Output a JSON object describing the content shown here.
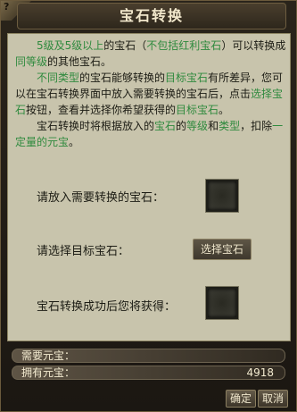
{
  "window": {
    "title": "宝石转换",
    "corner_text": "?"
  },
  "description": {
    "p1": [
      {
        "text": "5级及5级以上",
        "color": "#2f8a3e"
      },
      {
        "text": "的宝石（",
        "color": ""
      },
      {
        "text": "不包括红利宝石",
        "color": "#2f8a3e"
      },
      {
        "text": "）可以转换成",
        "color": ""
      },
      {
        "text": "同等级",
        "color": "#2f8a3e"
      },
      {
        "text": "的其他宝石。",
        "color": ""
      }
    ],
    "p2": [
      {
        "text": "不同类型",
        "color": "#2f8a3e"
      },
      {
        "text": "的宝石能够转换的",
        "color": ""
      },
      {
        "text": "目标宝石",
        "color": "#2f8a3e"
      },
      {
        "text": "有所差异，您可以在宝石转换界面中放入需要转换的宝石后，点击",
        "color": ""
      },
      {
        "text": "选择宝石",
        "color": "#2f8a3e"
      },
      {
        "text": "按钮，查看并选择你希望获得的",
        "color": ""
      },
      {
        "text": "目标宝石",
        "color": "#2f8a3e"
      },
      {
        "text": "。",
        "color": ""
      }
    ],
    "p3": [
      {
        "text": "宝石转换时将根据放入的",
        "color": ""
      },
      {
        "text": "宝石",
        "color": "#2f8a3e"
      },
      {
        "text": "的",
        "color": ""
      },
      {
        "text": "等级",
        "color": "#2f8a3e"
      },
      {
        "text": "和",
        "color": ""
      },
      {
        "text": "类型",
        "color": "#2f8a3e"
      },
      {
        "text": "，扣除",
        "color": ""
      },
      {
        "text": "一定量的元宝",
        "color": "#2f8a3e"
      },
      {
        "text": "。",
        "color": ""
      }
    ]
  },
  "form": {
    "put_gem_label": "请放入需要转换的宝石：",
    "target_gem_label": "请选择目标宝石：",
    "select_gem_button": "选择宝石",
    "result_label": "宝石转换成功后您将获得："
  },
  "currency": {
    "need_label": "需要元宝：",
    "need_value": "",
    "have_label": "拥有元宝：",
    "have_value": "4918"
  },
  "buttons": {
    "confirm": "确定",
    "cancel": "取消"
  }
}
